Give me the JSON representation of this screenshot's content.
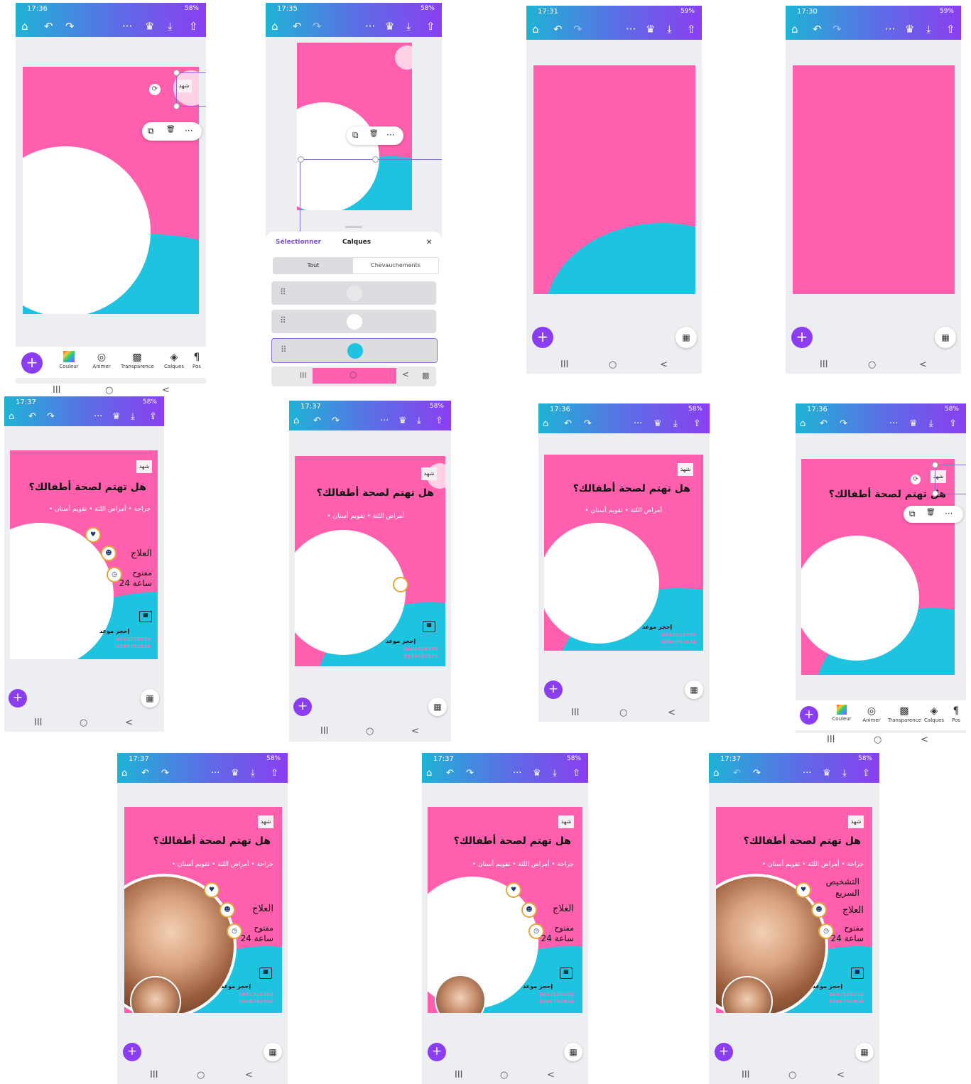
{
  "screens": [
    {
      "time": "17:36",
      "battery": "58%"
    },
    {
      "time": "17:35",
      "battery": "58%"
    },
    {
      "time": "17:31",
      "battery": "59%"
    },
    {
      "time": "17:30",
      "battery": "59%"
    },
    {
      "time": "17:37",
      "battery": "58%"
    },
    {
      "time": "17:37",
      "battery": "58%"
    },
    {
      "time": "17:36",
      "battery": "58%"
    },
    {
      "time": "17:36",
      "battery": "58%"
    },
    {
      "time": "17:37",
      "battery": "58%"
    },
    {
      "time": "17:37",
      "battery": "58%"
    },
    {
      "time": "17:37",
      "battery": "58%"
    }
  ],
  "icons": {
    "home": "⌂",
    "undo": "↶",
    "redo": "↷",
    "more": "···",
    "crown": "♛",
    "download": "⤓",
    "share": "⇧",
    "plus": "+",
    "grid": "▦",
    "nav_recent": "III",
    "nav_home": "○",
    "nav_back": "<",
    "copy": "⧉",
    "trash": "🗑",
    "rotate": "⟳",
    "heart": "♥",
    "person": "☻",
    "clock": "◷",
    "calendar": "▦",
    "close": "✕",
    "drag": "⠿"
  },
  "design": {
    "logo": "شهد",
    "title": "هل تهتم لصحة أطفالك؟",
    "cats_full": "• جراحة  • أمراض اللثة  • تقويم أسنان",
    "cats_short": "• أمراض اللثة  • تقويم أسنان",
    "treatment": "العلاج",
    "open": "مفتوح",
    "hours": "24 ساعة",
    "diagnosis_1": "التشخيص",
    "diagnosis_2": "السريع",
    "book": "إحجز موعد",
    "phone1": "0662528292",
    "phone2": "0586792826"
  },
  "toolbar": {
    "couleur": "Couleur",
    "animer": "Animer",
    "transparence": "Transparence",
    "calques": "Calques",
    "pos": "Pos"
  },
  "layers_panel": {
    "select": "Sélectionner",
    "title": "Calques",
    "tab_all": "Tout",
    "tab_overlaps": "Chevauchements"
  },
  "colors": {
    "pink": "#ff5fac",
    "cyan": "#1ec3e0",
    "purple": "#8b3df2"
  }
}
